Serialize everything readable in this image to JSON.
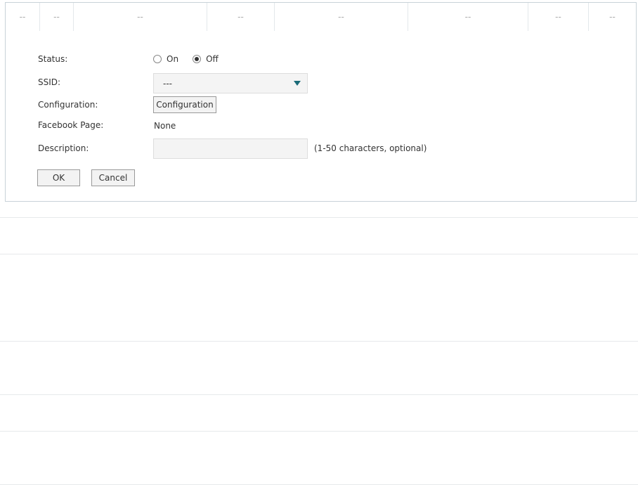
{
  "table_row": {
    "cells": [
      "--",
      "--",
      "--",
      "--",
      "--",
      "--",
      "--",
      "--"
    ]
  },
  "form": {
    "status": {
      "label": "Status:",
      "options": [
        "On",
        "Off"
      ],
      "selected": "Off"
    },
    "ssid": {
      "label": "SSID:",
      "value": "---"
    },
    "configuration": {
      "label": "Configuration:",
      "button_label": "Configuration"
    },
    "facebook_page": {
      "label": "Facebook Page:",
      "value": "None"
    },
    "description": {
      "label": "Description:",
      "value": "",
      "hint": "(1-50 characters, optional)"
    },
    "buttons": {
      "ok": "OK",
      "cancel": "Cancel"
    }
  },
  "colors": {
    "border": "#c8d2d8",
    "accent_arrow": "#1a6b78",
    "field_background": "#f4f4f4"
  },
  "icons": {
    "ssid_dropdown": "chevron-down-icon"
  }
}
